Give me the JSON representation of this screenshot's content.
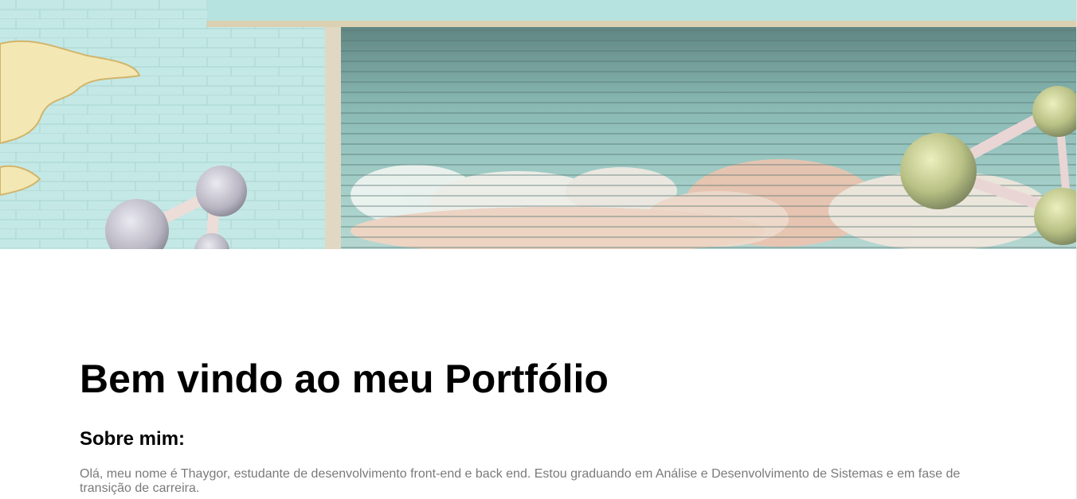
{
  "hero": {
    "image": "street-mural-photo",
    "colors": {
      "wall": "#b6e2df",
      "shutter": "#5e9b95",
      "cloud_peach": "#e9b79d"
    }
  },
  "main": {
    "title": "Bem vindo ao meu Portfólio",
    "about_heading": "Sobre mim:",
    "about_text": "Olá, meu nome é Thaygor, estudante de desenvolvimento front-end e back end. Estou graduando em Análise e Desenvolvimento de Sistemas e em fase de transição de carreira."
  }
}
